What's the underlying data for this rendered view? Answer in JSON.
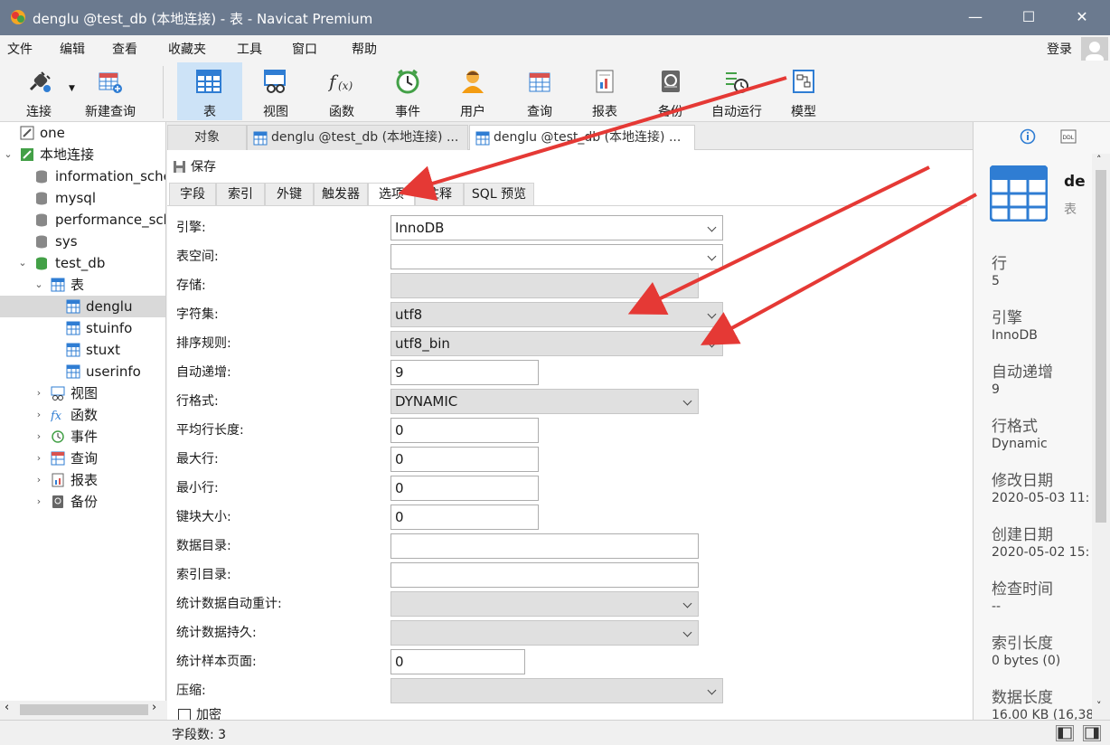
{
  "window": {
    "title": "denglu @test_db (本地连接) - 表 - Navicat Premium",
    "controls": [
      "—",
      "☐",
      "✕"
    ]
  },
  "menu": [
    "文件",
    "编辑",
    "查看",
    "收藏夹",
    "工具",
    "窗口",
    "帮助"
  ],
  "login_label": "登录",
  "toolbar": [
    {
      "label": "连接",
      "icon": "plug-icon"
    },
    {
      "label": "新建查询",
      "icon": "new-query-icon"
    },
    {
      "label": "表",
      "icon": "table-icon",
      "active": true
    },
    {
      "label": "视图",
      "icon": "view-icon"
    },
    {
      "label": "函数",
      "icon": "function-icon"
    },
    {
      "label": "事件",
      "icon": "clock-icon"
    },
    {
      "label": "用户",
      "icon": "user-icon"
    },
    {
      "label": "查询",
      "icon": "query-icon"
    },
    {
      "label": "报表",
      "icon": "report-icon"
    },
    {
      "label": "备份",
      "icon": "backup-icon"
    },
    {
      "label": "自动运行",
      "icon": "schedule-icon"
    },
    {
      "label": "模型",
      "icon": "model-icon"
    }
  ],
  "tree": [
    {
      "label": "one",
      "icon": "connection-icon"
    },
    {
      "label": "本地连接",
      "icon": "connection-icon",
      "expanded": true
    },
    {
      "label": "information_schema",
      "icon": "database-icon"
    },
    {
      "label": "mysql",
      "icon": "database-icon"
    },
    {
      "label": "performance_schema",
      "icon": "database-icon"
    },
    {
      "label": "sys",
      "icon": "database-icon"
    },
    {
      "label": "test_db",
      "icon": "database-icon",
      "expanded": true
    },
    {
      "label": "表",
      "icon": "table-folder-icon",
      "expanded": true
    },
    {
      "label": "denglu",
      "icon": "table-icon",
      "selected": true
    },
    {
      "label": "stuinfo",
      "icon": "table-icon"
    },
    {
      "label": "stuxt",
      "icon": "table-icon"
    },
    {
      "label": "userinfo",
      "icon": "table-icon"
    },
    {
      "label": "视图",
      "icon": "view-icon"
    },
    {
      "label": "函数",
      "icon": "function-icon"
    },
    {
      "label": "事件",
      "icon": "clock-icon"
    },
    {
      "label": "查询",
      "icon": "query-icon"
    },
    {
      "label": "报表",
      "icon": "report-icon"
    },
    {
      "label": "备份",
      "icon": "backup-icon"
    }
  ],
  "doc_tabs": [
    "对象",
    "denglu @test_db (本地连接) ...",
    "denglu @test_db (本地连接) ..."
  ],
  "save_label": "保存",
  "sub_tabs": [
    "字段",
    "索引",
    "外键",
    "触发器",
    "选项",
    "注释",
    "SQL 预览"
  ],
  "active_sub_tab": "选项",
  "options": [
    {
      "label": "引擎:",
      "value": "InnoDB"
    },
    {
      "label": "表空间:",
      "value": ""
    },
    {
      "label": "存储:",
      "value": ""
    },
    {
      "label": "字符集:",
      "value": "utf8"
    },
    {
      "label": "排序规则:",
      "value": "utf8_bin"
    },
    {
      "label": "自动递增:",
      "value": "9"
    },
    {
      "label": "行格式:",
      "value": "DYNAMIC"
    },
    {
      "label": "平均行长度:",
      "value": "0"
    },
    {
      "label": "最大行:",
      "value": "0"
    },
    {
      "label": "最小行:",
      "value": "0"
    },
    {
      "label": "键块大小:",
      "value": "0"
    },
    {
      "label": "数据目录:",
      "value": ""
    },
    {
      "label": "索引目录:",
      "value": ""
    },
    {
      "label": "统计数据自动重计:",
      "value": ""
    },
    {
      "label": "统计数据持久:",
      "value": ""
    },
    {
      "label": "统计样本页面:",
      "value": "0"
    },
    {
      "label": "压缩:",
      "value": ""
    }
  ],
  "encrypt_label": "加密",
  "info": {
    "name": "de",
    "type": "表",
    "props": [
      {
        "key": "行",
        "value": "5"
      },
      {
        "key": "引擎",
        "value": "InnoDB"
      },
      {
        "key": "自动递增",
        "value": "9"
      },
      {
        "key": "行格式",
        "value": "Dynamic"
      },
      {
        "key": "修改日期",
        "value": "2020-05-03 11:"
      },
      {
        "key": "创建日期",
        "value": "2020-05-02 15:"
      },
      {
        "key": "检查时间",
        "value": "--"
      },
      {
        "key": "索引长度",
        "value": "0 bytes (0)"
      },
      {
        "key": "数据长度",
        "value": "16.00 KB (16,38"
      }
    ]
  },
  "status": "字段数: 3",
  "colors": {
    "titlebar": "#6b7a8f",
    "accent": "#2f7dd3",
    "annotation": "#e53935"
  }
}
